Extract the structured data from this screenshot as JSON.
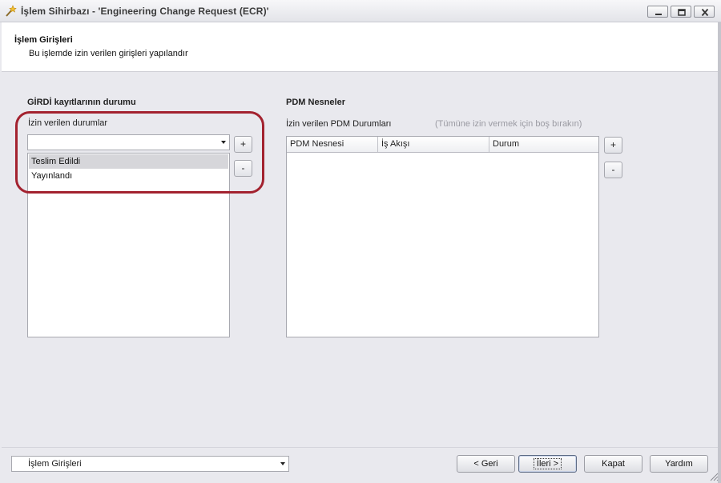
{
  "window": {
    "title": "İşlem Sihirbazı - 'Engineering Change Request (ECR)'",
    "icon": "wizard-wand-icon",
    "controls": [
      "minimize-icon",
      "maximize-icon",
      "close-icon"
    ]
  },
  "header": {
    "title": "İşlem Girişleri",
    "subtitle": "Bu işlemde izin verilen girişleri yapılandır"
  },
  "left_panel": {
    "section_title": "GİRDİ kayıtlarının durumu",
    "field_label": "İzin verilen durumlar",
    "combo_value": "",
    "add_label": "+",
    "remove_label": "-",
    "items": [
      {
        "label": "Teslim Edildi",
        "selected": true
      },
      {
        "label": "Yayınlandı",
        "selected": false
      }
    ]
  },
  "right_panel": {
    "section_title": "PDM Nesneler",
    "field_label": "İzin verilen PDM Durumları",
    "hint": "(Tümüne izin vermek için boş bırakın)",
    "add_label": "+",
    "remove_label": "-",
    "columns": [
      "PDM Nesnesi",
      "İş Akışı",
      "Durum"
    ],
    "rows": []
  },
  "footer": {
    "page_selector_value": "İşlem Girişleri",
    "back_label": "< Geri",
    "next_label": "İleri >",
    "close_label": "Kapat",
    "help_label": "Yardım"
  },
  "colors": {
    "highlight": "#a3222f",
    "background": "#e9e9ee",
    "selected_row": "#d6d6da"
  }
}
